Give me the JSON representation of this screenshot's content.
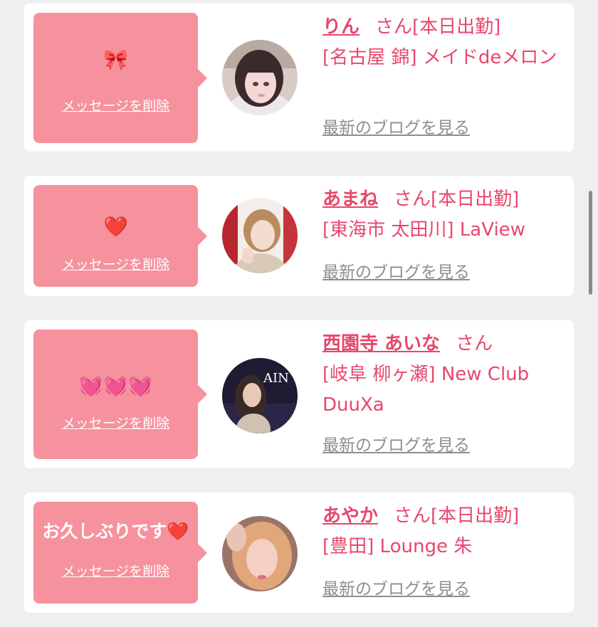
{
  "colors": {
    "accent": "#e8476c",
    "bubble": "#f6919e",
    "link_gray": "#8e8e8e",
    "background": "#efefef"
  },
  "messages": [
    {
      "name": "りん",
      "suffix": "さん[本日出勤]",
      "shop": "[名古屋 錦] メイドdeメロン",
      "message_text": "🎀",
      "delete_label": "メッセージを削除",
      "blog_link": "最新のブログを見る"
    },
    {
      "name": "あまね",
      "suffix": "さん[本日出勤]",
      "shop": "[東海市 太田川] LaView",
      "message_text": "❤️",
      "delete_label": "メッセージを削除",
      "blog_link": "最新のブログを見る"
    },
    {
      "name": "西園寺 あいな",
      "suffix": "さん",
      "shop": "[岐阜 柳ヶ瀬] New Club DuuXa",
      "message_text": "💓💓💓",
      "delete_label": "メッセージを削除",
      "blog_link": "最新のブログを見る"
    },
    {
      "name": "あやか",
      "suffix": "さん[本日出勤]",
      "shop": "[豊田] Lounge 朱",
      "message_text": "お久しぶりです❤️",
      "delete_label": "メッセージを削除",
      "blog_link": "最新のブログを見る"
    }
  ]
}
